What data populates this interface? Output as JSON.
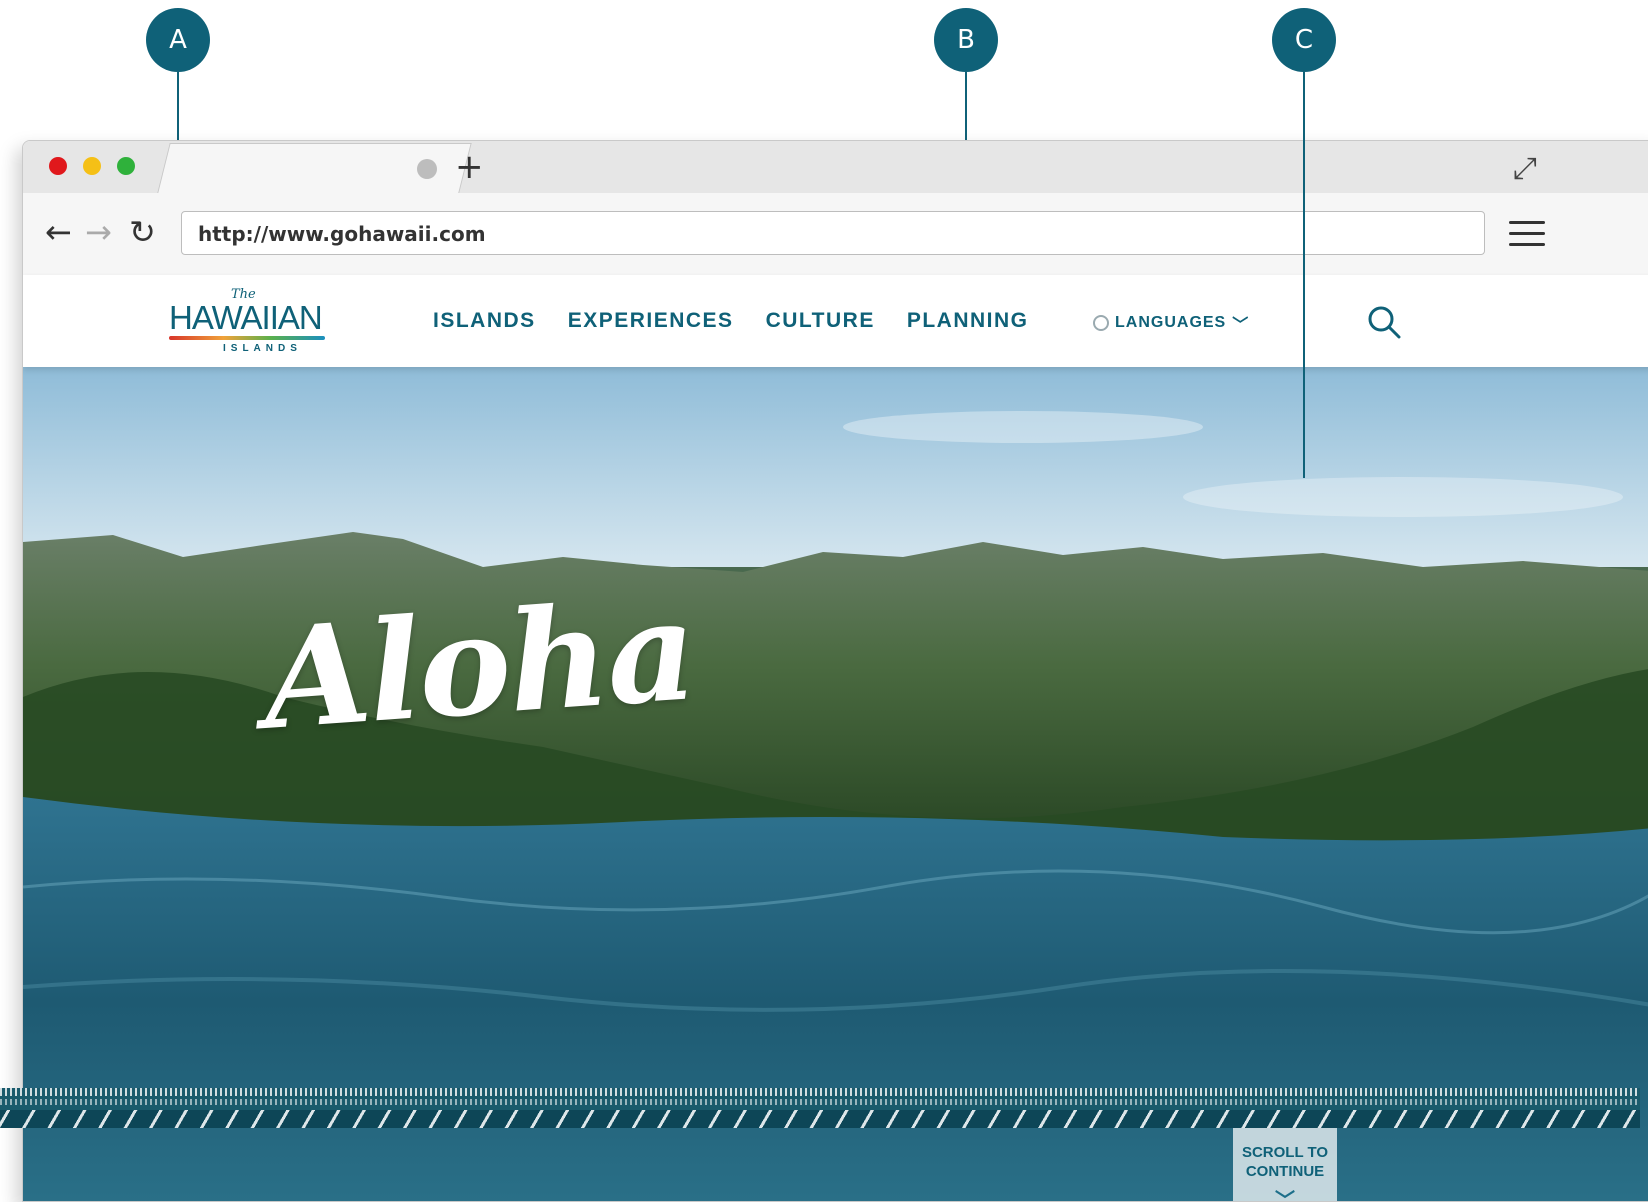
{
  "callouts": {
    "a": "A",
    "b": "B",
    "c": "C"
  },
  "browser": {
    "url": "http://www.gohawaii.com",
    "new_tab_symbol": "+",
    "back_symbol": "←",
    "forward_symbol": "→",
    "reload_symbol": "↻",
    "fullscreen_symbol": "⤢"
  },
  "site": {
    "logo": {
      "the": "The",
      "main": "HAWAIIAN",
      "sub": "ISLANDS"
    },
    "nav": [
      "ISLANDS",
      "EXPERIENCES",
      "CULTURE",
      "PLANNING"
    ],
    "languages_label": "LANGUAGES",
    "hero_title": "Aloha",
    "scroll_label_1": "SCROLL TO",
    "scroll_label_2": "CONTINUE"
  },
  "colors": {
    "brand": "#0f6178",
    "dot_red": "#e0181c",
    "dot_yellow": "#f5c016",
    "dot_green": "#2fb13b"
  },
  "icons": {
    "search": "search-icon",
    "globe": "globe-icon",
    "menu": "hamburger-menu-icon"
  }
}
